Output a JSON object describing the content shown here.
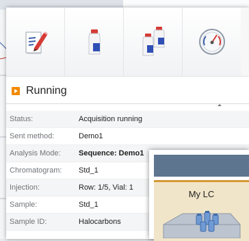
{
  "toolbar": {
    "buttons": [
      {
        "name": "sequence-editor-button",
        "icon": "document-pencil-icon"
      },
      {
        "name": "single-run-button",
        "icon": "sample-bottle-icon"
      },
      {
        "name": "sequence-run-button",
        "icon": "multiple-bottles-icon"
      },
      {
        "name": "instrument-status-button",
        "icon": "gauge-icon"
      }
    ]
  },
  "status_section": {
    "title": "Running"
  },
  "info_rows": [
    {
      "label": "Status:",
      "value": "Acquisition running",
      "bold": false
    },
    {
      "label": "Sent method:",
      "value": "Demo1",
      "bold": false
    },
    {
      "label": "Analysis Mode:",
      "value": "Sequence: Demo1",
      "bold": true
    },
    {
      "label": "Chromatogram:",
      "value": "Std_1",
      "bold": false
    },
    {
      "label": "Injection:",
      "value": "Row: 1/5, Vial: 1",
      "bold": false
    },
    {
      "label": "Sample:",
      "value": "Std_1",
      "bold": false
    },
    {
      "label": "Sample ID:",
      "value": "Halocarbons",
      "bold": false
    }
  ],
  "instrument": {
    "name": "My LC"
  },
  "colors": {
    "accent": "#f18a00",
    "instrument_header": "#5e7590",
    "instrument_body": "#f1e5c9",
    "instrument_stripe": "#d69836"
  }
}
